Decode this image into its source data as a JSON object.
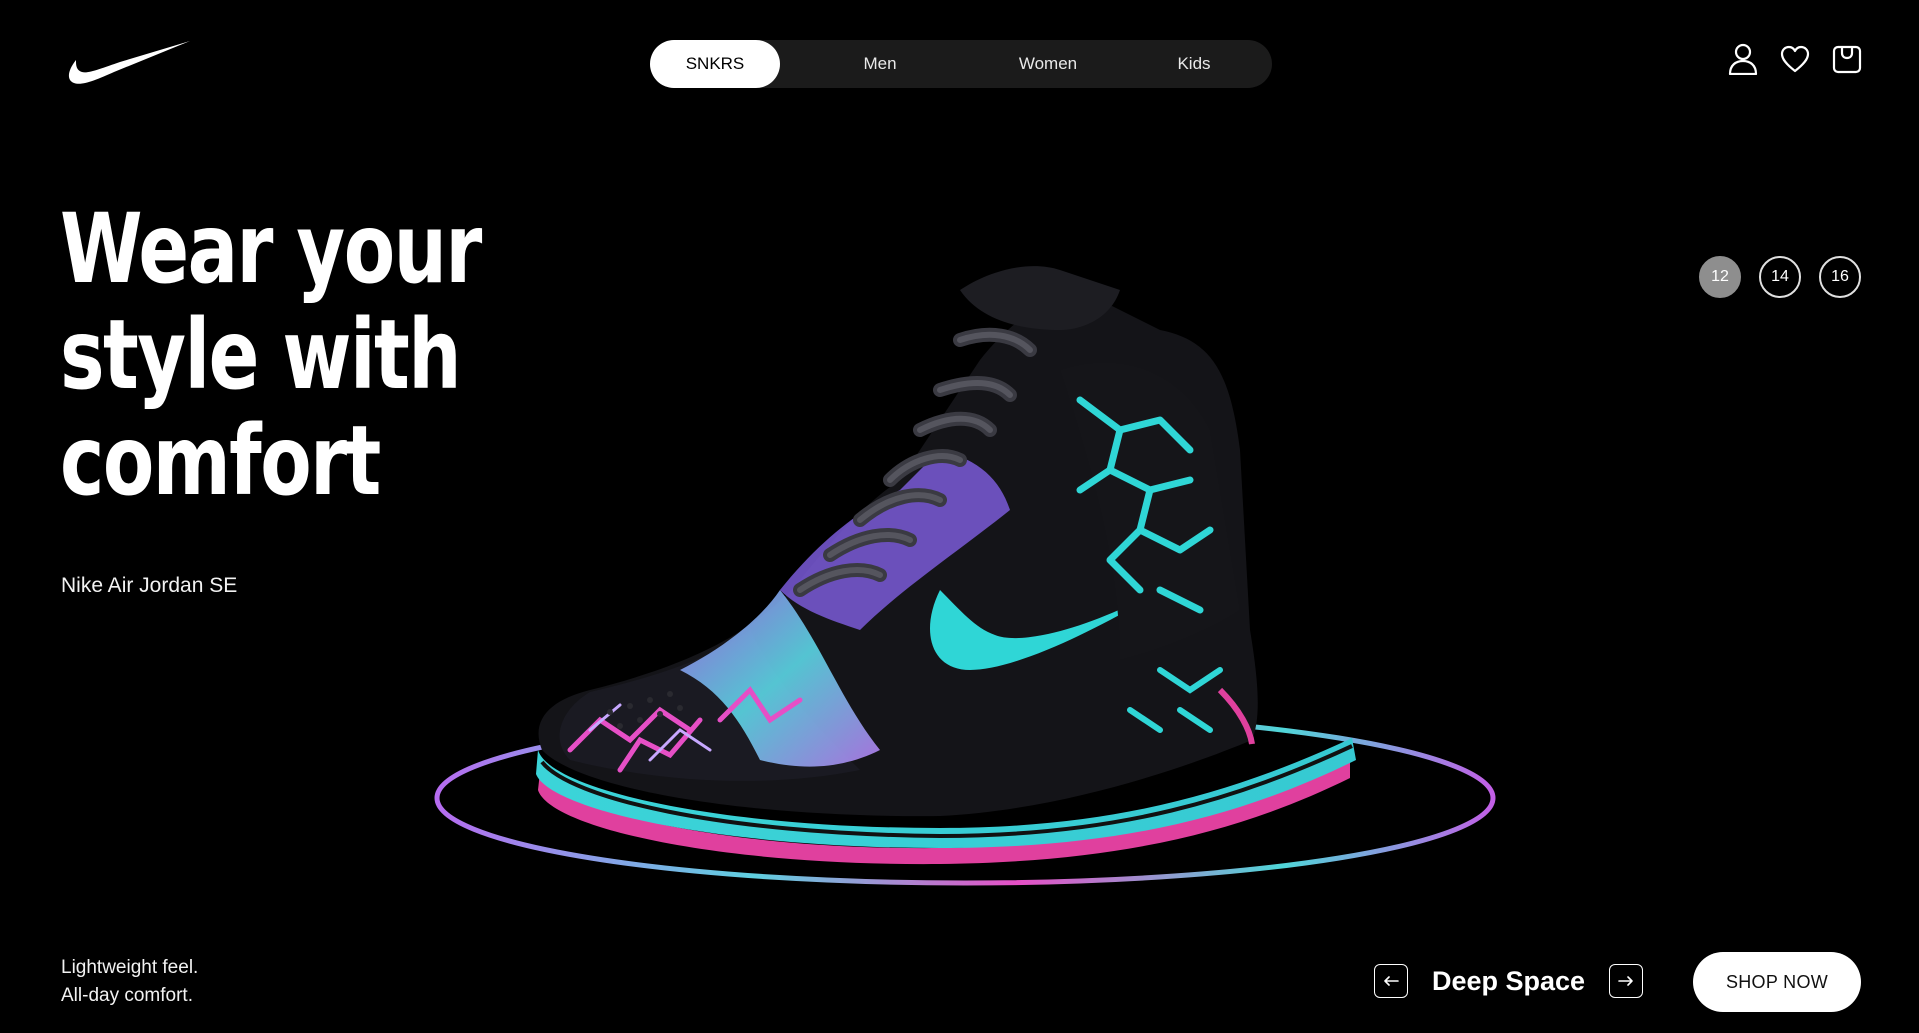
{
  "header": {
    "nav_tabs": [
      {
        "label": "SNKRS",
        "active": true
      },
      {
        "label": "Men",
        "active": false
      },
      {
        "label": "Women",
        "active": false
      },
      {
        "label": "Kids",
        "active": false
      }
    ],
    "icons": [
      "user-icon",
      "heart-icon",
      "bag-icon"
    ]
  },
  "hero": {
    "title_line1": "Wear your",
    "title_line2": "style with",
    "title_line3": "comfort",
    "product_name": "Nike Air Jordan SE"
  },
  "sizes": {
    "options": [
      "12",
      "14",
      "16"
    ],
    "selected": "12"
  },
  "footer": {
    "tagline_line1": "Lightweight feel.",
    "tagline_line2": "All-day comfort.",
    "colorway": "Deep Space",
    "prev_icon": "arrow-left-icon",
    "next_icon": "arrow-right-icon",
    "cta_label": "SHOP NOW"
  },
  "colors": {
    "background": "#000000",
    "nav_bg": "#1b1b1b",
    "accent_teal": "#2fd6d6",
    "accent_pink": "#e83fbf",
    "accent_purple": "#9b6cf0"
  }
}
